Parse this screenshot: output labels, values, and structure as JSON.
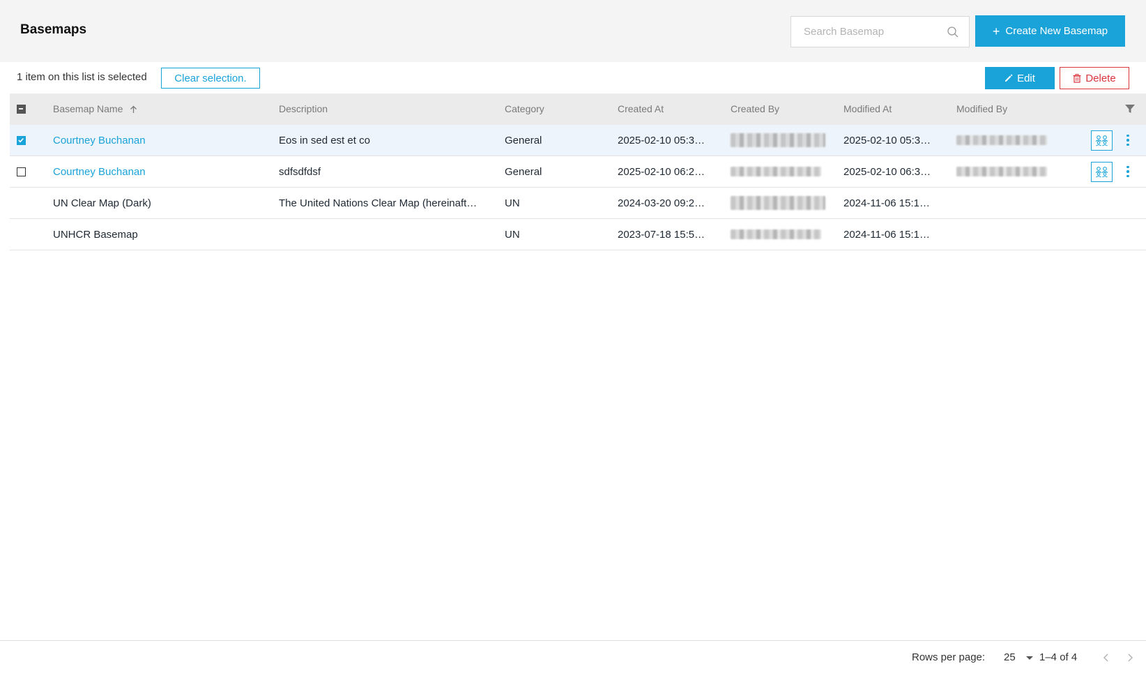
{
  "header": {
    "title": "Basemaps",
    "search_placeholder": "Search Basemap",
    "create_label": "Create New Basemap"
  },
  "selection": {
    "text": "1 item on this list is selected",
    "clear_label": "Clear selection.",
    "edit_label": "Edit",
    "delete_label": "Delete"
  },
  "table": {
    "columns": [
      "Basemap Name",
      "Description",
      "Category",
      "Created At",
      "Created By",
      "Modified At",
      "Modified By"
    ],
    "sort": {
      "column": "Basemap Name",
      "direction": "ascending"
    },
    "rows": [
      {
        "selectable": true,
        "checked": true,
        "name": "Courtney Buchanan",
        "description": "Eos in sed est et co",
        "category": "General",
        "created_at": "2025-02-10 05:3…",
        "modified_at": "2025-02-10 05:3…"
      },
      {
        "selectable": true,
        "checked": false,
        "name": "Courtney Buchanan",
        "description": "sdfsdfdsf",
        "category": "General",
        "created_at": "2025-02-10 06:2…",
        "modified_at": "2025-02-10 06:3…"
      },
      {
        "selectable": false,
        "checked": false,
        "name": "UN Clear Map (Dark)",
        "description": "The United Nations Clear Map (hereinaft…",
        "category": "UN",
        "created_at": "2024-03-20 09:2…",
        "modified_at": "2024-11-06 15:1…"
      },
      {
        "selectable": false,
        "checked": false,
        "name": "UNHCR Basemap",
        "description": "",
        "category": "UN",
        "created_at": "2023-07-18 15:5…",
        "modified_at": "2024-11-06 15:1…"
      }
    ]
  },
  "pagination": {
    "rows_per_page_label": "Rows per page:",
    "rows_per_page": "25",
    "range": "1–4 of 4"
  },
  "colors": {
    "accent": "#1aa3d9",
    "danger": "#d9363e",
    "header_bg": "#f4f4f4",
    "selected_row_bg": "#eef4fb"
  },
  "icons": [
    "search-icon",
    "plus-icon",
    "pencil-icon",
    "trash-icon",
    "sort-arrow-up-icon",
    "filter-icon",
    "share-users-icon",
    "more-vertical-icon",
    "chevron-left-icon",
    "chevron-right-icon",
    "chevron-down-icon"
  ]
}
